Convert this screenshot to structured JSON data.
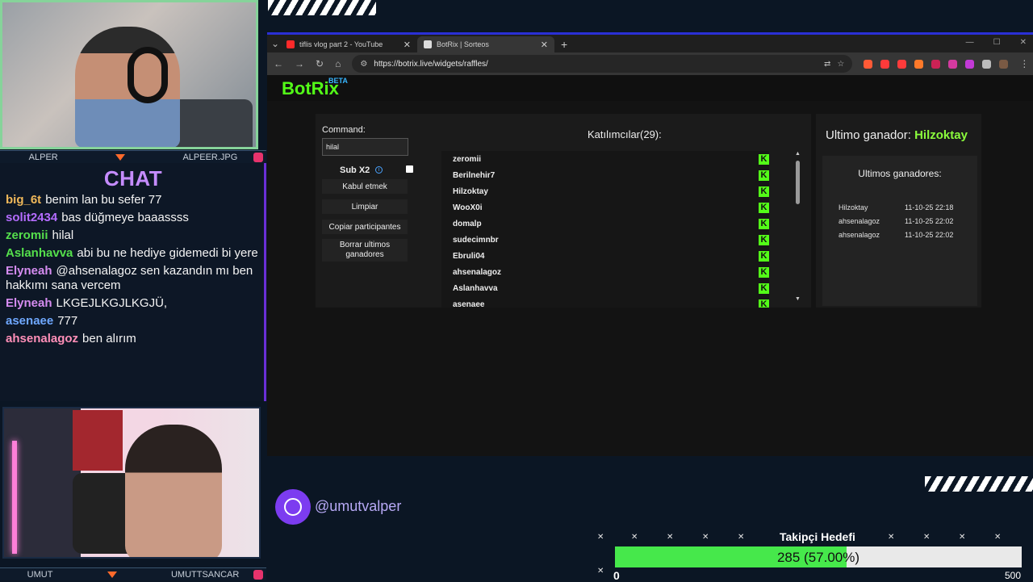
{
  "overlay": {
    "cam1_name_left": "ALPER",
    "cam1_name_right": "ALPEER.JPG",
    "cam2_name_left": "UMUT",
    "cam2_name_right": "UMUTTSANCAR",
    "chat_title": "CHAT",
    "social_handle": "@umutvalper",
    "goal_title": "Takipçi Hedefi",
    "goal_text": "285 (57.00%)",
    "goal_progress": 0.57,
    "goal_min": "0",
    "goal_max": "500"
  },
  "chat": {
    "messages": [
      {
        "user": "big_6t",
        "color": "#f0b85a",
        "text": "benim lan bu sefer 77"
      },
      {
        "user": "solit2434",
        "color": "#b46cff",
        "text": "bas düğmeye baaassss"
      },
      {
        "user": "zeromii",
        "color": "#55e04c",
        "text": "hilal"
      },
      {
        "user": "Aslanhavva",
        "color": "#55e04c",
        "text": "abi bu ne hediye gidemedi bi yere"
      },
      {
        "user": "Elyneah",
        "color": "#d58cf0",
        "text": "@ahsenalagoz sen kazandın mı ben hakkımı sana vercem"
      },
      {
        "user": "Elyneah",
        "color": "#d58cf0",
        "text": "LKGEJLKGJLKGJÜ,"
      },
      {
        "user": "asenaee",
        "color": "#6fa8ff",
        "text": "777"
      },
      {
        "user": "ahsenalagoz",
        "color": "#ff8fb8",
        "text": "ben alırım"
      }
    ]
  },
  "browser": {
    "tabs": [
      {
        "title": "tiflis vlog part 2 - YouTube",
        "favicon_color": "#ff2a2a",
        "active": false
      },
      {
        "title": "BotRix | Sorteos",
        "favicon_color": "#dddddd",
        "active": true
      }
    ],
    "url": "https://botrix.live/widgets/raffles/",
    "extension_colors": [
      "#ff5a36",
      "#ff3a3a",
      "#ff3b3b",
      "#ff7a2a",
      "#cc2255",
      "#d43aa0",
      "#c23ad6",
      "#bbbbbb",
      "#7a5a44"
    ]
  },
  "app": {
    "brand": "BotRix",
    "beta": "BETA",
    "command_label": "Command:",
    "command_value": "hilal",
    "sub_x2_label": "Sub X2",
    "buttons": {
      "accept": "Kabul etmek",
      "clear": "Limpiar",
      "copy": "Copiar participantes",
      "clear_winners": "Borrar ultimos ganadores"
    },
    "participants_title": "Katılımcılar(29):",
    "participants": [
      "zeromii",
      "Berilnehir7",
      "Hilzoktay",
      "WooX0i",
      "domalp",
      "sudecimnbr",
      "Ebruli04",
      "ahsenalagoz",
      "Aslanhavva",
      "asenaee"
    ],
    "kick_icon_char": "K",
    "last_winner_label": "Ultimo ganador:",
    "last_winner_name": "Hilzoktay",
    "winners_title": "Ultimos ganadores:",
    "winners": [
      {
        "name": "Hilzoktay",
        "date": "11-10-25 22:18"
      },
      {
        "name": "ahsenalagoz",
        "date": "11-10-25 22:02"
      },
      {
        "name": "ahsenalagoz",
        "date": "11-10-25 22:02"
      }
    ]
  }
}
